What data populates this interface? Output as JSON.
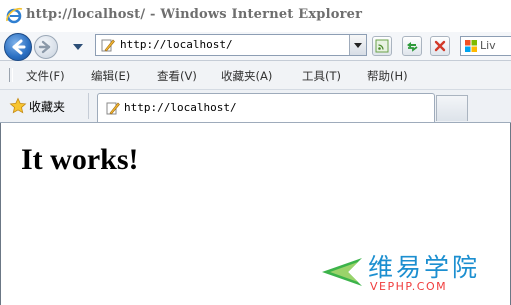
{
  "window": {
    "title": "http://localhost/ - Windows Internet Explorer",
    "icon": "ie-logo-icon"
  },
  "nav": {
    "back_icon": "back-arrow-icon",
    "forward_icon": "forward-arrow-icon",
    "address": "http://localhost/",
    "buttons": [
      "rss-feed-icon",
      "refresh-icon",
      "stop-icon"
    ],
    "search_text": "Liv"
  },
  "menu": {
    "items": [
      "文件(F)",
      "编辑(E)",
      "查看(V)",
      "收藏夹(A)",
      "工具(T)",
      "帮助(H)"
    ]
  },
  "favorites": {
    "label": "收藏夹",
    "tab_title": "http://localhost/"
  },
  "page": {
    "heading": "It works!"
  },
  "watermark": {
    "title": "维易学院",
    "subtitle": "VEPHP.COM",
    "colors": {
      "title": "#1c8fd0",
      "subtitle": "#f03c3c",
      "logo": "#3cb34a"
    }
  }
}
